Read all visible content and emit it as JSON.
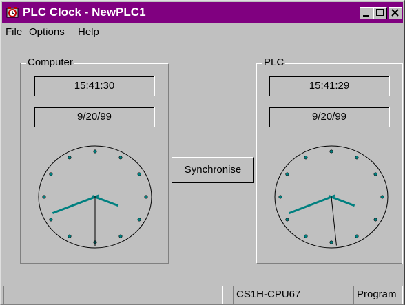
{
  "window": {
    "title": "PLC Clock - NewPLC1",
    "app_icon": "plc-clock-app-icon",
    "controls": {
      "minimize": "minimize-icon",
      "maximize": "maximize-icon",
      "close": "close-icon"
    },
    "colors": {
      "titlebar": "#800080",
      "face": "#c0c0c0",
      "hand_color": "#008080"
    }
  },
  "menu": {
    "items": [
      "File",
      "Options",
      "Help"
    ]
  },
  "computer": {
    "label": "Computer",
    "time": "15:41:30",
    "date": "9/20/99"
  },
  "plc": {
    "label": "PLC",
    "time": "15:41:29",
    "date": "9/20/99"
  },
  "sync_button": {
    "label": "Synchronise"
  },
  "statusbar": {
    "cpu": "CS1H-CPU67",
    "mode": "Program"
  }
}
